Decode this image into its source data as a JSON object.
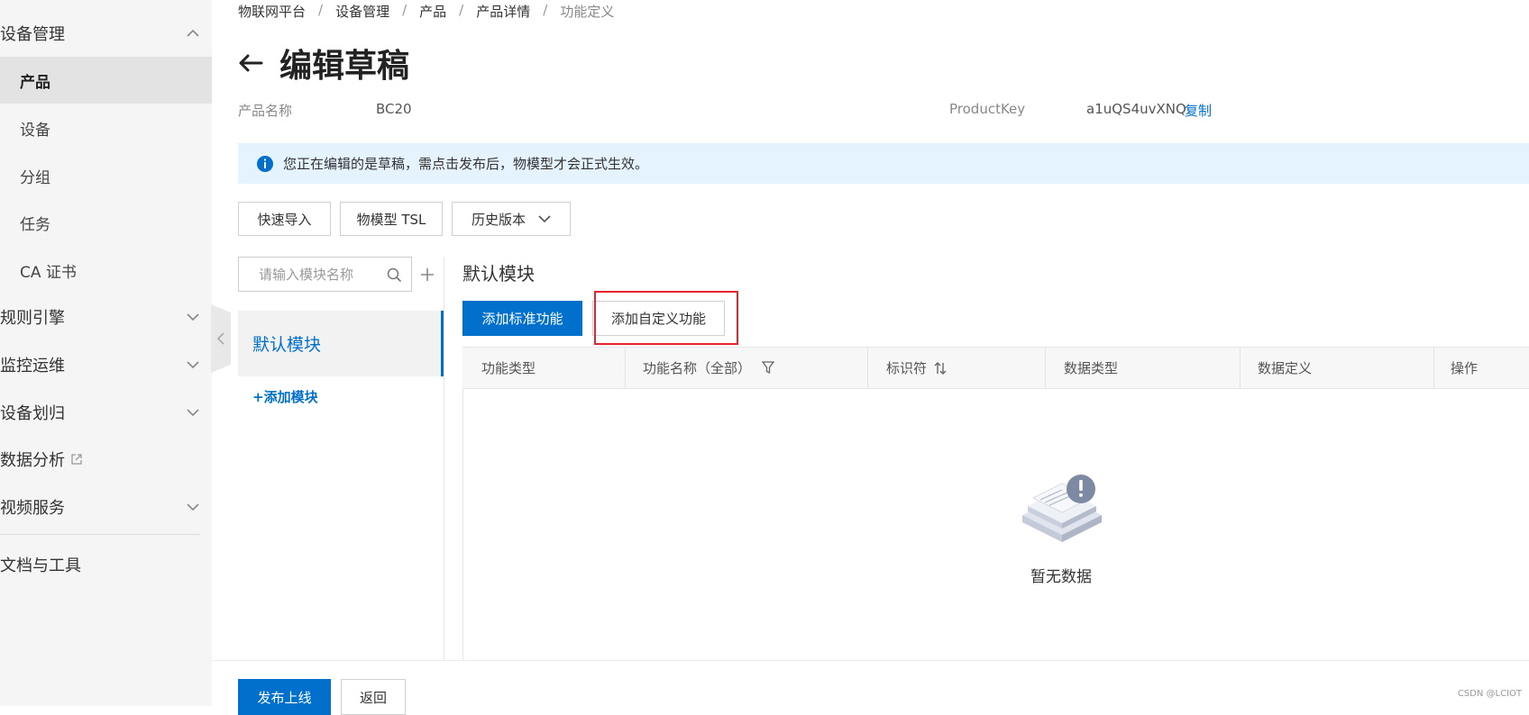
{
  "sidebar": {
    "items": [
      {
        "label": "设备管理",
        "type": "group",
        "chevron": "up"
      },
      {
        "label": "产品",
        "type": "sub",
        "active": true
      },
      {
        "label": "设备",
        "type": "sub"
      },
      {
        "label": "分组",
        "type": "sub"
      },
      {
        "label": "任务",
        "type": "sub"
      },
      {
        "label": "CA 证书",
        "type": "sub"
      },
      {
        "label": "规则引擎",
        "type": "group",
        "chevron": "down"
      },
      {
        "label": "监控运维",
        "type": "group",
        "chevron": "down"
      },
      {
        "label": "设备划归",
        "type": "group",
        "chevron": "down"
      },
      {
        "label": "数据分析",
        "type": "group",
        "external": true
      },
      {
        "label": "视频服务",
        "type": "group",
        "chevron": "down"
      },
      {
        "label": "文档与工具",
        "type": "group"
      }
    ]
  },
  "breadcrumb": [
    "物联网平台",
    "设备管理",
    "产品",
    "产品详情",
    "功能定义"
  ],
  "breadcrumb_sep": "/",
  "page_title": "编辑草稿",
  "product": {
    "name_label": "产品名称",
    "name_value": "BC20",
    "key_label": "ProductKey",
    "key_value": "a1uQS4uvXNQ",
    "copy_label": "复制"
  },
  "notice": "您正在编辑的是草稿，需点击发布后，物模型才会正式生效。",
  "toolbar": {
    "quick_import": "快速导入",
    "tsl": "物模型 TSL",
    "history": "历史版本"
  },
  "modules": {
    "search_placeholder": "请输入模块名称",
    "items": [
      "默认模块"
    ],
    "add_label": "+添加模块"
  },
  "content": {
    "section_title": "默认模块",
    "add_standard": "添加标准功能",
    "add_custom": "添加自定义功能",
    "columns": [
      "功能类型",
      "功能名称（全部）",
      "标识符",
      "数据类型",
      "数据定义",
      "操作"
    ],
    "empty_text": "暂无数据"
  },
  "footer": {
    "publish": "发布上线",
    "back": "返回"
  },
  "watermark": "CSDN @LCIOT",
  "colors": {
    "accent": "#0070cc",
    "notice_bg": "#e5f3fe",
    "highlight": "#e8232d"
  }
}
